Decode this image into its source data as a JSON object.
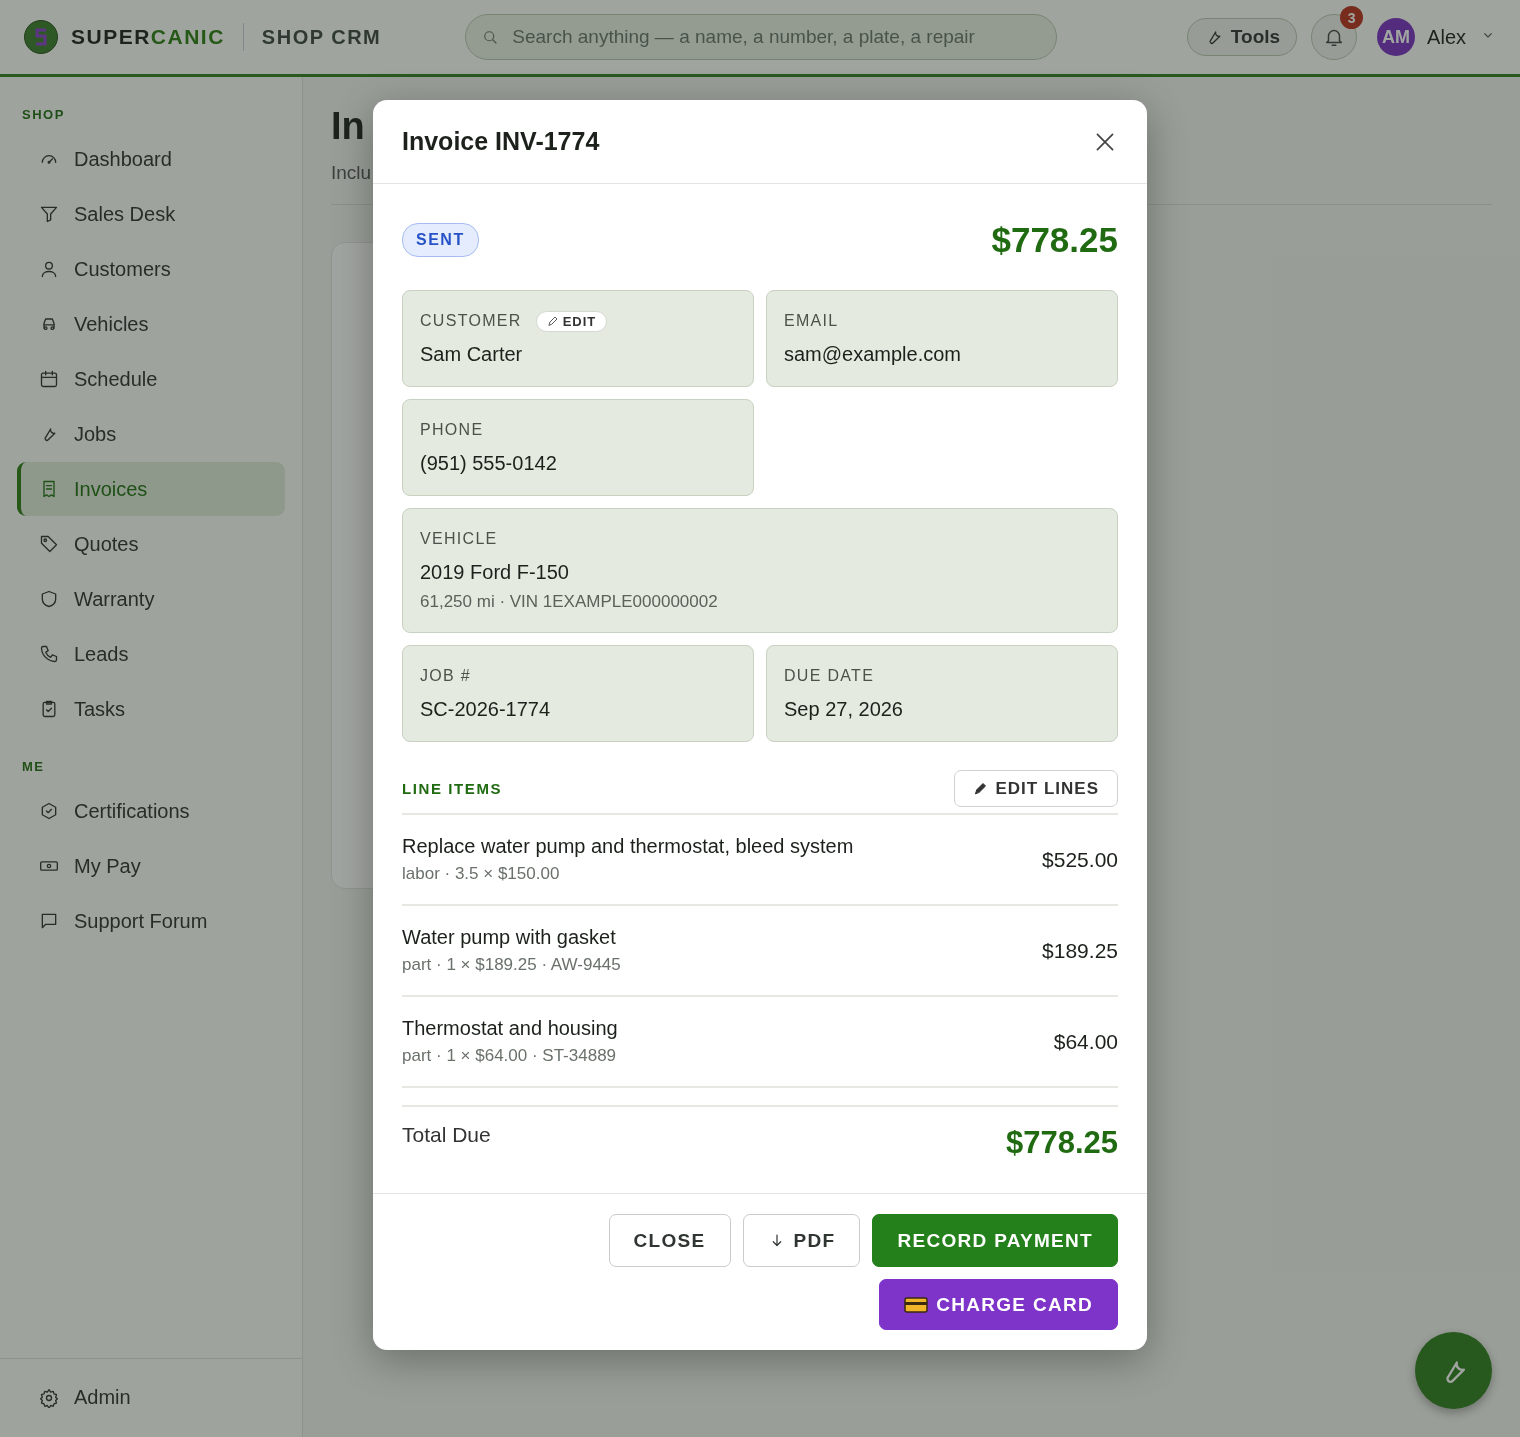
{
  "header": {
    "brand_dark": "SUPER",
    "brand_accent": "CANIC",
    "app_name": "SHOP CRM",
    "search": {
      "placeholder": "Search anything — a name, a number, a plate, a repair"
    },
    "tools": "Tools",
    "notifications": "3",
    "user": {
      "initials": "AM",
      "name": "Alex"
    }
  },
  "sidebar": {
    "sections": [
      {
        "title": "SHOP",
        "items": [
          {
            "label": "Dashboard",
            "selected": false
          },
          {
            "label": "Sales Desk",
            "selected": false
          },
          {
            "label": "Customers",
            "selected": false
          },
          {
            "label": "Vehicles",
            "selected": false
          },
          {
            "label": "Schedule",
            "selected": false
          },
          {
            "label": "Jobs",
            "selected": false
          },
          {
            "label": "Invoices",
            "selected": true
          },
          {
            "label": "Quotes",
            "selected": false
          },
          {
            "label": "Warranty",
            "selected": false
          },
          {
            "label": "Leads",
            "selected": false
          },
          {
            "label": "Tasks",
            "selected": false
          }
        ]
      },
      {
        "title": "ME",
        "items": [
          {
            "label": "Certifications",
            "selected": false
          },
          {
            "label": "My Pay",
            "selected": false
          },
          {
            "label": "Support Forum",
            "selected": false
          }
        ]
      }
    ],
    "footer": {
      "label": "Admin",
      "selected": false
    }
  },
  "page": {
    "title": "In",
    "subtitle": "Inclu"
  },
  "modal": {
    "title": "Invoice INV-1774",
    "status": "SENT",
    "amount": "$778.25",
    "fields": [
      {
        "label": "CUSTOMER",
        "value": "Sam Carter",
        "edit": "EDIT"
      },
      {
        "label": "EMAIL",
        "value": "sam@example.com"
      },
      {
        "label": "PHONE",
        "value": "(951) 555-0142"
      },
      {
        "label": "VEHICLE",
        "value": "2019 Ford F-150",
        "detail": "61,250 mi · VIN 1EXAMPLE000000002"
      },
      {
        "label": "JOB #",
        "value": "SC-2026-1774"
      },
      {
        "label": "DUE DATE",
        "value": "Sep 27, 2026"
      }
    ],
    "line_items": {
      "title": "LINE ITEMS",
      "edit": "EDIT LINES",
      "items": [
        {
          "description": "Replace water pump and thermostat, bleed system",
          "meta": "labor · 3.5 × $150.00",
          "amount": "$525.00"
        },
        {
          "description": "Water pump with gasket",
          "meta": "part · 1 × $189.25 · AW-9445",
          "amount": "$189.25"
        },
        {
          "description": "Thermostat and housing",
          "meta": "part · 1 × $64.00 · ST-34889",
          "amount": "$64.00"
        }
      ]
    },
    "total": {
      "label": "Total Due",
      "value": "$778.25"
    },
    "buttons": [
      {
        "label": "CLOSE",
        "kind": "outline"
      },
      {
        "label": "PDF",
        "kind": "download"
      },
      {
        "label": "RECORD PAYMENT",
        "kind": "primary"
      },
      {
        "label": "CHARGE CARD",
        "kind": "card"
      }
    ]
  }
}
